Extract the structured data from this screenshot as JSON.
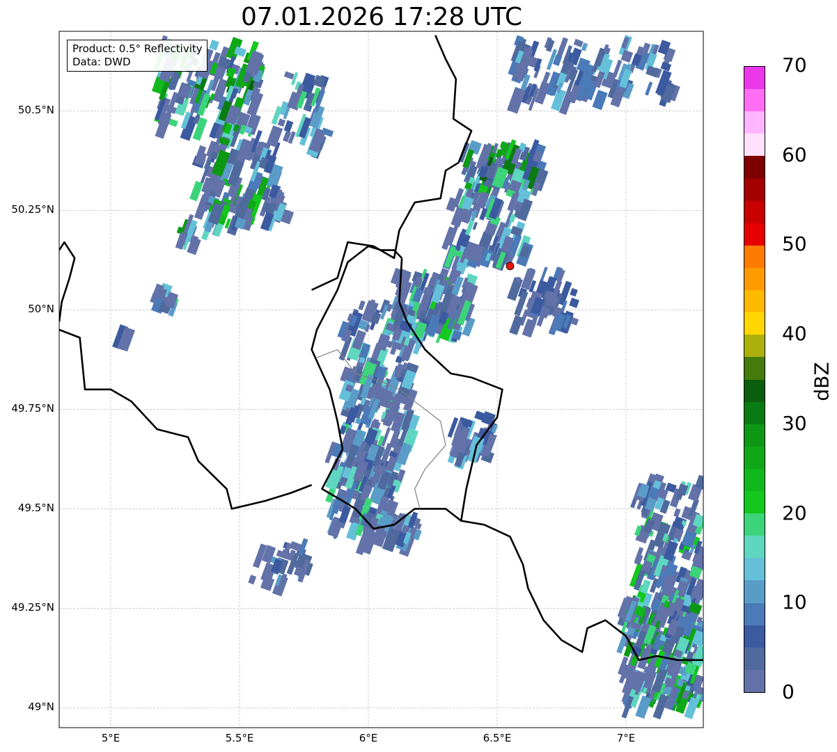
{
  "title": "07.01.2026 17:28 UTC",
  "info_box": {
    "product": "Product: 0.5° Reflectivity",
    "data": "Data: DWD"
  },
  "map": {
    "lon_range": [
      4.8,
      7.3
    ],
    "lat_range": [
      48.95,
      50.7
    ],
    "lat_ticks": [
      {
        "value": 50.5,
        "label": "50.5°N"
      },
      {
        "value": 50.25,
        "label": "50.25°N"
      },
      {
        "value": 50.0,
        "label": "50°N"
      },
      {
        "value": 49.75,
        "label": "49.75°N"
      },
      {
        "value": 49.5,
        "label": "49.5°N"
      },
      {
        "value": 49.25,
        "label": "49.25°N"
      },
      {
        "value": 49.0,
        "label": "49°N"
      }
    ],
    "lon_ticks": [
      {
        "value": 5.0,
        "label": "5°E"
      },
      {
        "value": 5.5,
        "label": "5.5°E"
      },
      {
        "value": 6.0,
        "label": "6°E"
      },
      {
        "value": 6.5,
        "label": "6.5°E"
      },
      {
        "value": 7.0,
        "label": "7°E"
      }
    ],
    "radar_site": {
      "lon": 6.55,
      "lat": 50.11,
      "color": "#e8140f"
    },
    "borders": {
      "france_belgium_west": [
        [
          4.8,
          50.15
        ],
        [
          4.82,
          50.17
        ],
        [
          4.86,
          50.13
        ],
        [
          4.84,
          50.08
        ],
        [
          4.81,
          50.02
        ],
        [
          4.8,
          49.97
        ]
      ],
      "france_belgium_south": [
        [
          4.8,
          49.95
        ],
        [
          4.88,
          49.93
        ],
        [
          4.9,
          49.8
        ],
        [
          5.0,
          49.8
        ],
        [
          5.08,
          49.77
        ],
        [
          5.18,
          49.7
        ],
        [
          5.3,
          49.68
        ],
        [
          5.34,
          49.62
        ],
        [
          5.45,
          49.55
        ],
        [
          5.47,
          49.5
        ],
        [
          5.6,
          49.52
        ],
        [
          5.7,
          49.54
        ],
        [
          5.78,
          49.56
        ]
      ],
      "belgium_germany": [
        [
          5.78,
          50.05
        ],
        [
          5.88,
          50.08
        ],
        [
          5.92,
          50.17
        ],
        [
          6.02,
          50.16
        ],
        [
          6.1,
          50.13
        ],
        [
          6.12,
          50.2
        ],
        [
          6.18,
          50.27
        ],
        [
          6.28,
          50.28
        ],
        [
          6.3,
          50.35
        ],
        [
          6.35,
          50.37
        ],
        [
          6.4,
          50.45
        ],
        [
          6.33,
          50.48
        ],
        [
          6.34,
          50.58
        ],
        [
          6.3,
          50.63
        ],
        [
          6.26,
          50.69
        ]
      ],
      "luxembourg": [
        [
          6.13,
          50.13
        ],
        [
          6.12,
          50.02
        ],
        [
          6.15,
          49.97
        ],
        [
          6.22,
          49.9
        ],
        [
          6.32,
          49.84
        ],
        [
          6.4,
          49.83
        ],
        [
          6.52,
          49.8
        ],
        [
          6.5,
          49.73
        ],
        [
          6.42,
          49.66
        ],
        [
          6.38,
          49.55
        ],
        [
          6.36,
          49.47
        ],
        [
          6.3,
          49.5
        ],
        [
          6.18,
          49.5
        ],
        [
          6.1,
          49.46
        ],
        [
          6.02,
          49.45
        ],
        [
          5.95,
          49.5
        ],
        [
          5.9,
          49.52
        ],
        [
          5.82,
          49.55
        ],
        [
          5.9,
          49.65
        ],
        [
          5.88,
          49.72
        ],
        [
          5.85,
          49.8
        ],
        [
          5.78,
          49.9
        ],
        [
          5.8,
          49.95
        ],
        [
          5.84,
          50.0
        ],
        [
          5.88,
          50.05
        ],
        [
          5.92,
          50.12
        ],
        [
          6.0,
          50.16
        ],
        [
          6.05,
          50.15
        ],
        [
          6.1,
          50.15
        ],
        [
          6.13,
          50.13
        ]
      ],
      "germany_france_south": [
        [
          6.36,
          49.47
        ],
        [
          6.45,
          49.46
        ],
        [
          6.55,
          49.43
        ],
        [
          6.6,
          49.36
        ],
        [
          6.62,
          49.3
        ],
        [
          6.68,
          49.22
        ],
        [
          6.75,
          49.17
        ],
        [
          6.83,
          49.14
        ],
        [
          6.85,
          49.2
        ],
        [
          6.92,
          49.22
        ],
        [
          7.0,
          49.18
        ],
        [
          7.05,
          49.12
        ],
        [
          7.12,
          49.13
        ],
        [
          7.2,
          49.12
        ],
        [
          7.3,
          49.12
        ]
      ],
      "internal": [
        [
          5.8,
          49.88
        ],
        [
          5.88,
          49.9
        ],
        [
          5.95,
          49.84
        ],
        [
          6.05,
          49.82
        ],
        [
          6.12,
          49.8
        ],
        [
          6.2,
          49.76
        ],
        [
          6.28,
          49.72
        ],
        [
          6.3,
          49.66
        ],
        [
          6.22,
          49.6
        ],
        [
          6.18,
          49.55
        ],
        [
          6.2,
          49.5
        ]
      ]
    }
  },
  "colorbar": {
    "unit": "dBZ",
    "min": 0,
    "max": 70,
    "labels": [
      "0",
      "10",
      "20",
      "30",
      "40",
      "50",
      "60",
      "70"
    ],
    "colors": [
      "#6372a8",
      "#506a9e",
      "#3c5aa0",
      "#4b7ab8",
      "#5a9cc8",
      "#64c0d9",
      "#5fd6bf",
      "#3cd47a",
      "#14c81e",
      "#10b81c",
      "#0fa817",
      "#0c9814",
      "#0a7b12",
      "#0a5e0d",
      "#457b0b",
      "#acb00c",
      "#ffd700",
      "#ffba00",
      "#ff9b00",
      "#ff7b00",
      "#e60000",
      "#c80000",
      "#a50000",
      "#7f0000",
      "#ffe1ff",
      "#ffb5ff",
      "#ff6ef5",
      "#eb37ea"
    ]
  }
}
